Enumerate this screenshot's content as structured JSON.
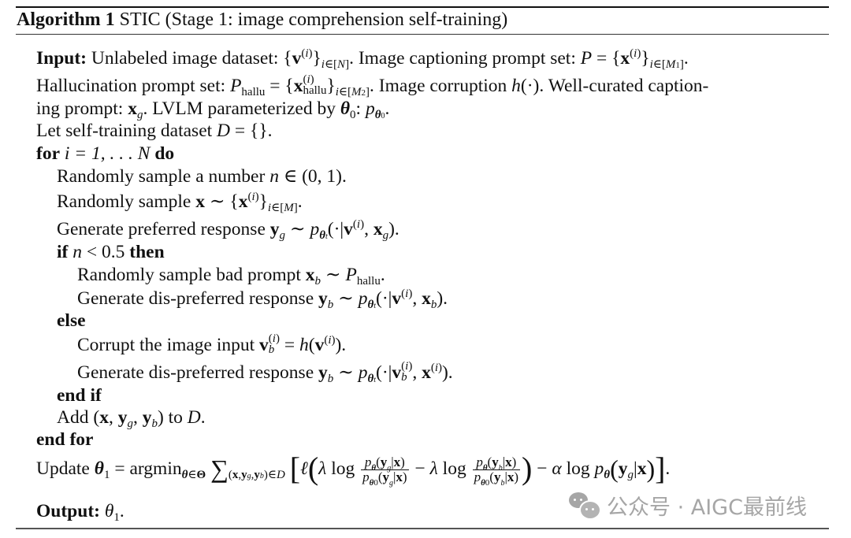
{
  "algorithm": {
    "label": "Algorithm 1",
    "title": "STIC (Stage 1: image comprehension self-training)"
  },
  "lines": {
    "input_kw": "Input:",
    "input_text1": "Unlabeled image dataset:",
    "input_text2": "Image captioning prompt set:",
    "halluc_text": "Hallucination prompt set:",
    "corruption_text": "Image corruption",
    "wellcurated_text": "Well-curated caption-",
    "ing_prompt_text": "ing prompt:",
    "lvlm_text": "LVLM parameterized by",
    "let_text": "Let self-training dataset",
    "for_kw": "for",
    "do_kw": "do",
    "sample_number_text": "Randomly sample a number",
    "sample_x_text": "Randomly sample",
    "gen_pref_text": "Generate preferred response",
    "if_kw": "if",
    "then_kw": "then",
    "bad_prompt_text": "Randomly sample bad prompt",
    "gen_dispref_text": "Generate dis-preferred response",
    "else_kw": "else",
    "corrupt_text": "Corrupt the image input",
    "gen_dispref2_text": "Generate dis-preferred response",
    "endif_kw": "end if",
    "add_text": "Add",
    "to_text": "to",
    "endfor_kw": "end for",
    "update_text": "Update",
    "output_kw": "Output:"
  },
  "math": {
    "threshold": "0.5",
    "interval": "(0, 1)",
    "loop_range": "i = 1, . . . N"
  },
  "watermark": {
    "text": "公众号 · AIGC最前线",
    "icon": "wechat-icon"
  }
}
